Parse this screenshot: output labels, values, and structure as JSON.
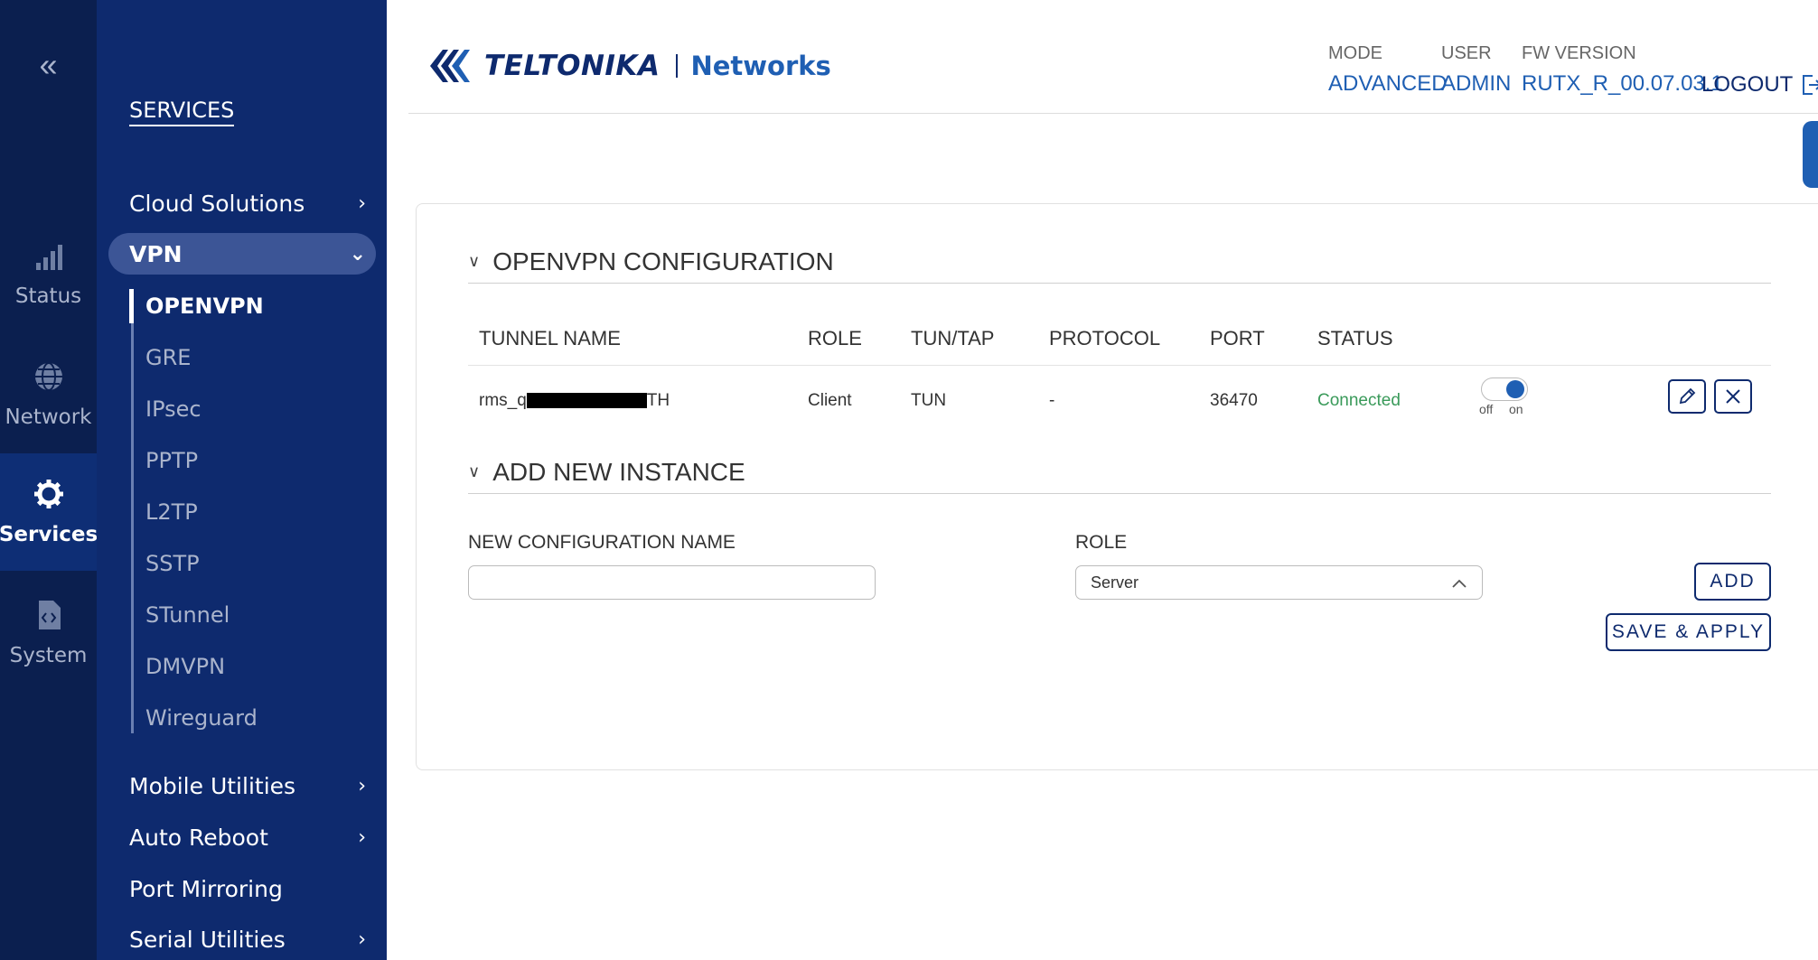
{
  "rail": {
    "items": [
      {
        "label": "Status",
        "icon": "signal-icon"
      },
      {
        "label": "Network",
        "icon": "globe-icon"
      },
      {
        "label": "Services",
        "icon": "gear-icon"
      },
      {
        "label": "System",
        "icon": "file-code-icon"
      }
    ]
  },
  "sidebar": {
    "title": "SERVICES",
    "cloud_solutions": "Cloud Solutions",
    "vpn": "VPN",
    "vpn_sub": [
      "OPENVPN",
      "GRE",
      "IPsec",
      "PPTP",
      "L2TP",
      "SSTP",
      "STunnel",
      "DMVPN",
      "Wireguard"
    ],
    "mobile_utilities": "Mobile Utilities",
    "auto_reboot": "Auto Reboot",
    "port_mirroring": "Port Mirroring",
    "serial_utilities": "Serial Utilities"
  },
  "header": {
    "brand": "TELTONIKA",
    "brand_sub": "Networks",
    "mode_label": "MODE",
    "mode_value": "ADVANCED",
    "user_label": "USER",
    "user_value": "ADMIN",
    "fw_label": "FW VERSION",
    "fw_value": "RUTX_R_00.07.03.1",
    "logout": "LOGOUT"
  },
  "openvpn": {
    "section_title": "OPENVPN CONFIGURATION",
    "columns": [
      "TUNNEL NAME",
      "ROLE",
      "TUN/TAP",
      "PROTOCOL",
      "PORT",
      "STATUS"
    ],
    "row": {
      "name_prefix": "rms_q",
      "name_suffix": "TH",
      "role": "Client",
      "tuntap": "TUN",
      "protocol": "-",
      "port": "36470",
      "status": "Connected",
      "toggle_off": "off",
      "toggle_on": "on",
      "enabled": true
    }
  },
  "add_instance": {
    "section_title": "ADD NEW INSTANCE",
    "name_label": "NEW CONFIGURATION NAME",
    "name_value": "",
    "role_label": "ROLE",
    "role_value": "Server",
    "add_button": "ADD",
    "save_button": "SAVE & APPLY"
  },
  "colors": {
    "rail_bg": "#0b1f4f",
    "sidebar_bg": "#0e2a6e",
    "accent": "#1f5fb3",
    "status_ok": "#3a9a5a"
  }
}
